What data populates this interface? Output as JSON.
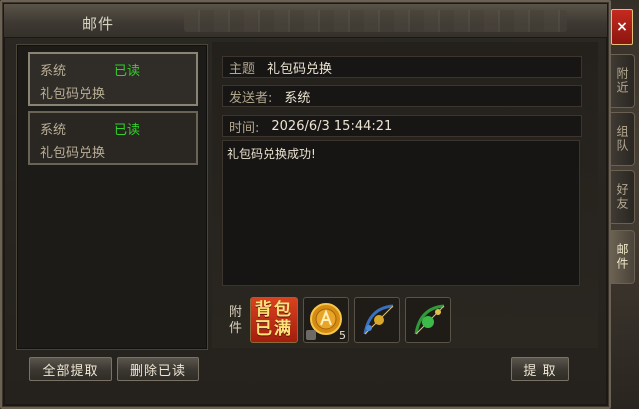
{
  "window": {
    "title": "邮件"
  },
  "close": {
    "label": "×"
  },
  "side_tabs": [
    {
      "label": "附近"
    },
    {
      "label": "组队"
    },
    {
      "label": "好友"
    },
    {
      "label": "邮件"
    }
  ],
  "mail_list": [
    {
      "sender": "系统",
      "status": "已读",
      "subject": "礼包码兑换"
    },
    {
      "sender": "系统",
      "status": "已读",
      "subject": "礼包码兑换"
    }
  ],
  "detail": {
    "subject_label": "主题",
    "subject_value": "礼包码兑换",
    "sender_label": "发送者:",
    "sender_value": "系统",
    "time_label": "时间:",
    "time_value": "2026/6/3 15:44:21",
    "body": "礼包码兑换成功!"
  },
  "attachments": {
    "label": "附件",
    "bag_full_line1": "背包",
    "bag_full_line2": "已满",
    "items": [
      {
        "icon": "gold-coin-icon",
        "quantity": "5"
      },
      {
        "icon": "bow-icon",
        "quantity": ""
      },
      {
        "icon": "green-bow-icon",
        "quantity": ""
      }
    ]
  },
  "buttons": {
    "collect_all": "全部提取",
    "delete_read": "删除已读",
    "collect": "提 取"
  },
  "colors": {
    "read_status": "#32d02a",
    "close_button": "#c62a1e",
    "bag_full": "#d9421f"
  }
}
